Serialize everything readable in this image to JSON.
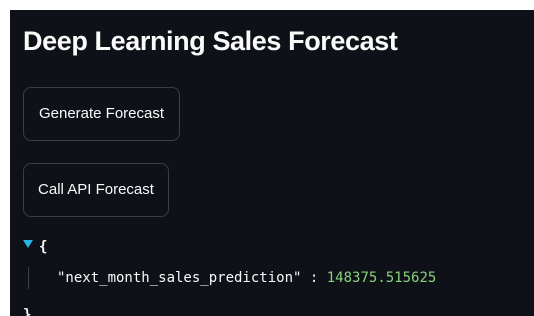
{
  "header": {
    "title": "Deep Learning Sales Forecast"
  },
  "buttons": {
    "generate_label": "Generate Forecast",
    "api_label": "Call API Forecast"
  },
  "json_output": {
    "open_brace": "{",
    "key": "\"next_month_sales_prediction\"",
    "separator": ":",
    "value": "148375.515625",
    "close_brace": "}"
  },
  "colors": {
    "background": "#0e1117",
    "text": "#fafafa",
    "button_border": "#3b3e47",
    "json_value": "#8bd17c",
    "toggle_arrow": "#29b5e8"
  },
  "icons": {
    "toggle": "caret-down-icon"
  }
}
